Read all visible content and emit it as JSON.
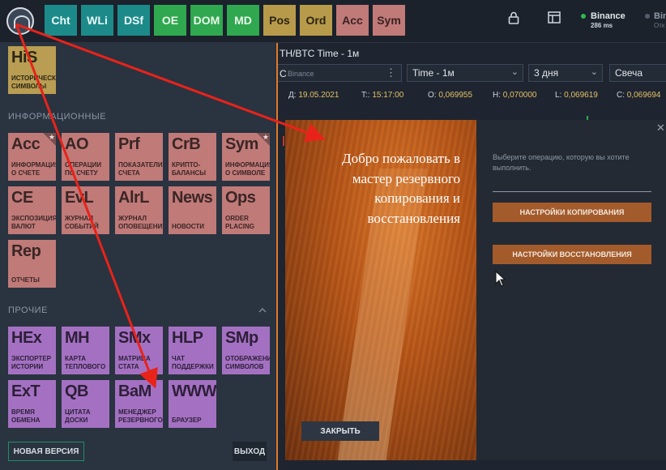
{
  "topbar": {
    "buttons": [
      {
        "label": "Cht",
        "bg": "#1d8a8a",
        "fg": "#e8f7f7"
      },
      {
        "label": "WLi",
        "bg": "#1d8a8a",
        "fg": "#e8f7f7"
      },
      {
        "label": "DSf",
        "bg": "#1d8a8a",
        "fg": "#e8f7f7"
      },
      {
        "label": "OE",
        "bg": "#2fa84f",
        "fg": "#eaf6ea"
      },
      {
        "label": "DOM",
        "bg": "#2fa84f",
        "fg": "#eaf6ea"
      },
      {
        "label": "MD",
        "bg": "#2fa84f",
        "fg": "#eaf6ea"
      },
      {
        "label": "Pos",
        "bg": "#b79a4a",
        "fg": "#2b2413"
      },
      {
        "label": "Ord",
        "bg": "#b79a4a",
        "fg": "#2b2413"
      },
      {
        "label": "Acc",
        "bg": "#c07a78",
        "fg": "#3a2222"
      },
      {
        "label": "Sym",
        "bg": "#c07a78",
        "fg": "#3a2222"
      }
    ],
    "lock_icon": "lock-icon",
    "layout_icon": "layout-icon",
    "connection": {
      "name": "Binance",
      "ping": "286 ms",
      "dot": "#2fb84f"
    },
    "connection2": {
      "name": "Bin",
      "sub": "Отк",
      "dot": "#555e6a"
    }
  },
  "sidebar": {
    "top_tile": {
      "big": "HiS",
      "small": "ИСТОРИЧЕСКИЕ СИМВОЛЫ"
    },
    "info_header": "ИНФОРМАЦИОННЫЕ",
    "info_tiles": [
      {
        "big": "Acc",
        "small": "ИНФОРМАЦИЯ О СЧЕТЕ",
        "star": true
      },
      {
        "big": "AO",
        "small": "ОПЕРАЦИИ ПО СЧЕТУ",
        "star": false
      },
      {
        "big": "Prf",
        "small": "ПОКАЗАТЕЛИ СЧЕТА",
        "star": false
      },
      {
        "big": "CrB",
        "small": "КРИПТО- БАЛАНСЫ",
        "star": false
      },
      {
        "big": "Sym",
        "small": "ИНФОРМАЦИЯ О СИМВОЛЕ",
        "star": true
      },
      {
        "big": "CE",
        "small": "ЭКСПОЗИЦИЯ ВАЛЮТ",
        "star": false
      },
      {
        "big": "EvL",
        "small": "ЖУРНАЛ СОБЫТИЙ",
        "star": false
      },
      {
        "big": "AlrL",
        "small": "ЖУРНАЛ ОПОВЕЩЕНИЙ",
        "star": false
      },
      {
        "big": "News",
        "small": "НОВОСТИ",
        "star": false
      },
      {
        "big": "Ops",
        "small": "ORDER PLACING",
        "star": false
      },
      {
        "big": "Rep",
        "small": "ОТЧЕТЫ",
        "star": false
      }
    ],
    "other_header": "ПРОЧИЕ",
    "collapse_icon": "chevron-up-icon",
    "other_tiles": [
      {
        "big": "HEx",
        "small": "ЭКСПОРТЕР ИСТОРИИ"
      },
      {
        "big": "MH",
        "small": "КАРТА ТЕПЛОВОГО"
      },
      {
        "big": "SMx",
        "small": "МАТРИЦА СТАТА"
      },
      {
        "big": "HLP",
        "small": "ЧАТ ПОДДЕРЖКИ"
      },
      {
        "big": "SMp",
        "small": "ОТОБРАЖЕНИЕ СИМВОЛОВ"
      },
      {
        "big": "ExT",
        "small": "ВРЕМЯ ОБМЕНА"
      },
      {
        "big": "QB",
        "small": "ЦИТАТА ДОСКИ"
      },
      {
        "big": "BaM",
        "small": "МЕНЕДЖЕР РЕЗЕРВНОГО"
      },
      {
        "big": "WWW",
        "small": "БРАУЗЕР"
      }
    ],
    "new_version": "НОВАЯ ВЕРСИЯ",
    "exit": "ВЫХОД"
  },
  "chart": {
    "title": "TH/BTC Time - 1м",
    "symbol_prefix": "C",
    "exchange": "Binance",
    "more_icon": "more-vertical-icon",
    "timeframe": "Time - 1м",
    "period": "3 дня",
    "style": "Свеча",
    "date_label": "Д:",
    "date_value": "19.05.2021",
    "time_label": "T::",
    "time_value": "15:17:00",
    "open_label": "O:",
    "open_value": "0,069955",
    "high_label": "H:",
    "high_value": "0,070000",
    "low_label": "L:",
    "low_value": "0,069619",
    "close_label": "C:",
    "close_value": "0,069694"
  },
  "modal": {
    "welcome": "Добро пожаловать в мастер резервного копирования и восстановления",
    "close_button": "ЗАКРЫТЬ",
    "prompt": "Выберите операцию, которую вы хотите выполнить.",
    "backup_button": "НАСТРОЙКИ КОПИРОВАНИЯ",
    "restore_button": "НАСТРОЙКИ ВОССТАНОВЛЕНИЯ",
    "close_icon": "close-icon"
  },
  "colors": {
    "accent": "#e07b2c",
    "annotation_arrow": "#e8231a"
  }
}
